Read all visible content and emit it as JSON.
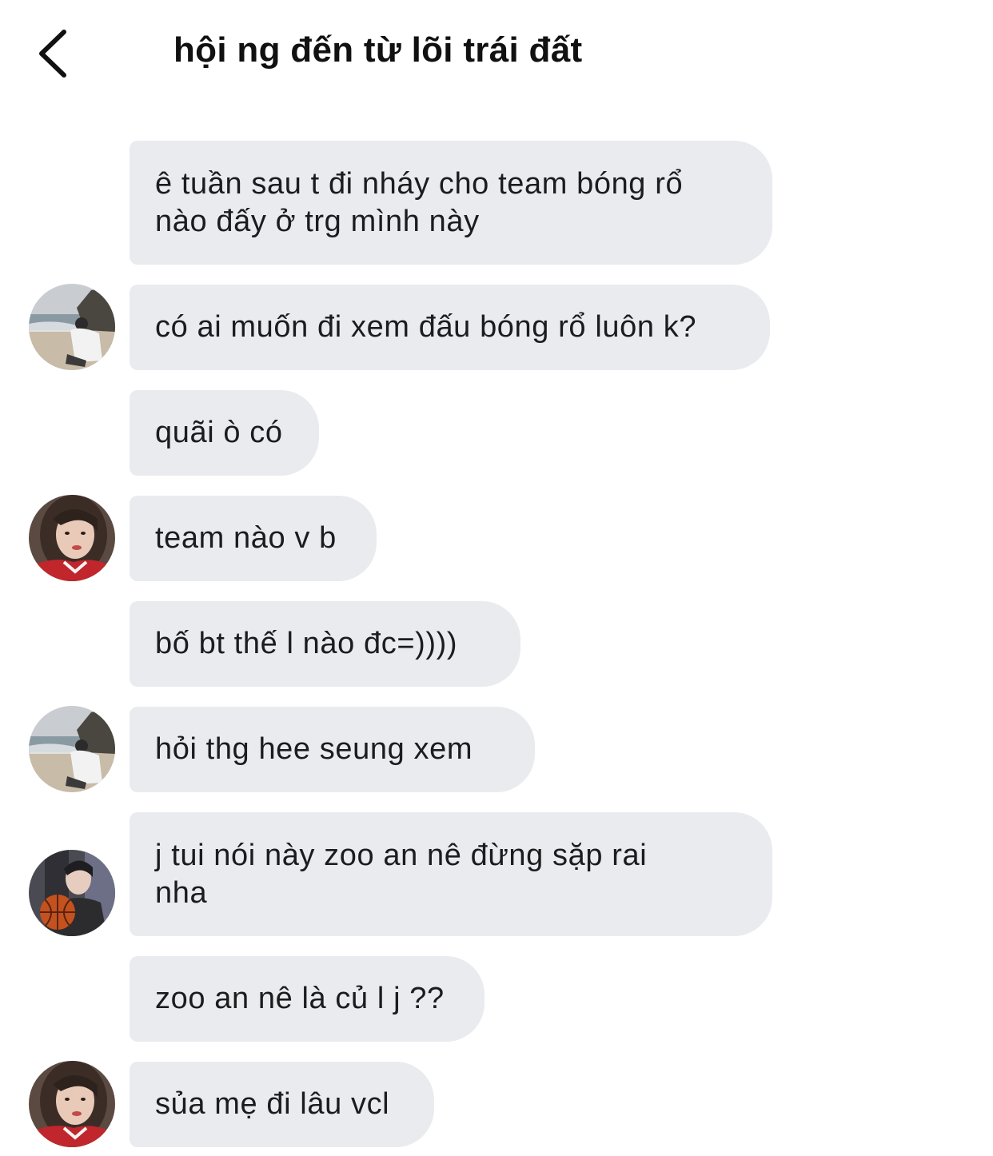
{
  "header": {
    "title": "hội ng đến từ lõi trái đất",
    "back_icon": "chevron-left-icon"
  },
  "messages": [
    {
      "text": "ê tuần sau t đi nháy cho team bóng rổ\nnào đấy ở trg mình này",
      "avatar": null
    },
    {
      "text": "có ai muốn đi xem đấu bóng rổ luôn k?",
      "avatar": "beach-person-avatar"
    },
    {
      "text": "quãi ò có",
      "avatar": null
    },
    {
      "text": "team nào v b",
      "avatar": "girl-red-jacket-avatar"
    },
    {
      "text": "bố bt thế l nào đc=))))",
      "avatar": null
    },
    {
      "text": "hỏi thg hee seung xem",
      "avatar": "beach-person-avatar"
    },
    {
      "text": "j tui nói này zoo an nê đừng sặp rai\nnha",
      "avatar": "guy-basketball-avatar"
    },
    {
      "text": "zoo an nê là củ l j ??",
      "avatar": null
    },
    {
      "text": "sủa mẹ đi lâu vcl",
      "avatar": "girl-red-jacket-avatar"
    }
  ],
  "colors": {
    "bubble_bg": "#e9ebef",
    "text": "#1c1c1e",
    "background": "#ffffff"
  }
}
